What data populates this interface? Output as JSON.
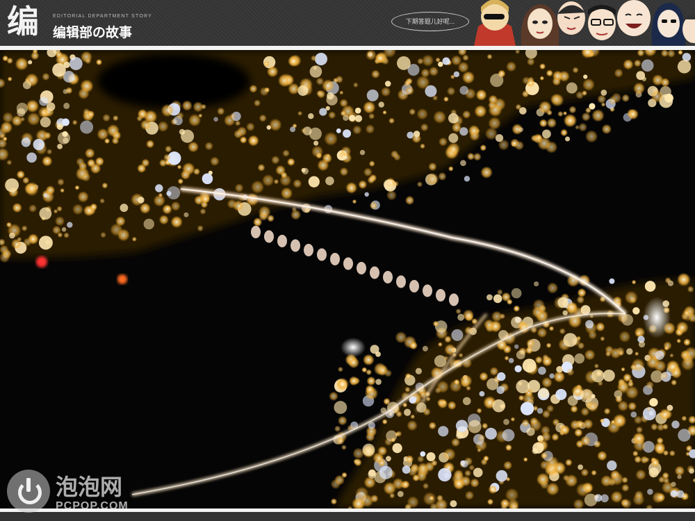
{
  "header": {
    "logo_glyph": "编",
    "logo_subtitle": "EDITORIAL DEPARTMENT STORY",
    "logo_title": "编辑部の故事",
    "speech_bubble": "下期答题儿好呢..."
  },
  "watermark": {
    "name": "泡泡网",
    "domain": "PCPOP.COM"
  },
  "colors": {
    "background": "#2b2b2b",
    "rule": "#f4f4f4",
    "city_light": "#f2b13a",
    "water": "#050505"
  }
}
